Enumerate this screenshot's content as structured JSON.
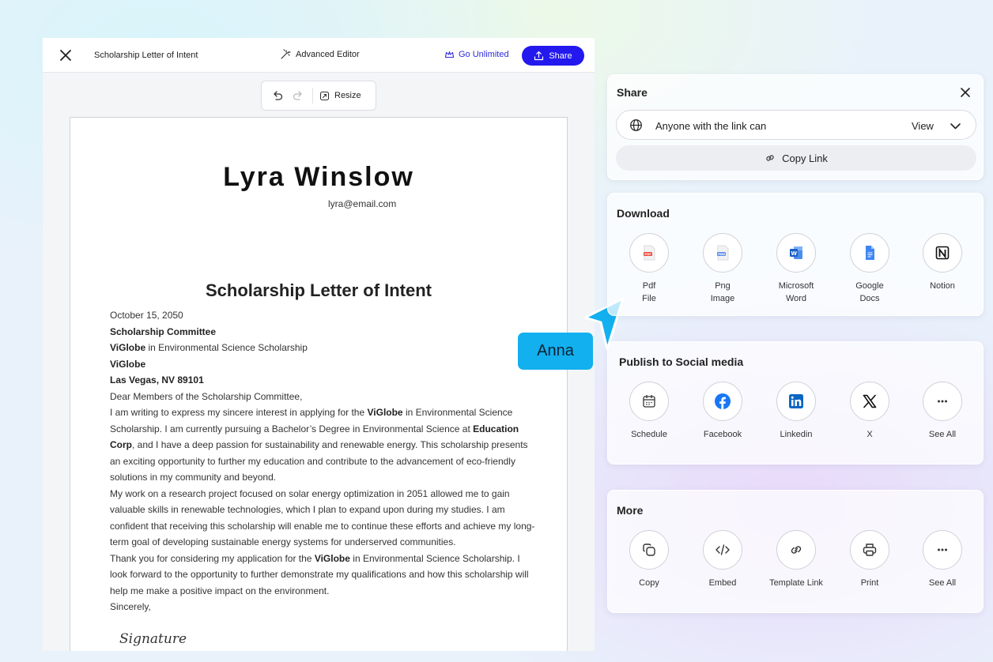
{
  "editor": {
    "doc_title": "Scholarship Letter of Intent",
    "advanced_editor": "Advanced Editor",
    "go_unlimited": "Go Unlimited",
    "share": "Share",
    "resize": "Resize"
  },
  "document": {
    "name": "Lyra Winslow",
    "email": "lyra@email.com",
    "title": "Scholarship Letter of Intent",
    "date": "October 15, 2050",
    "recipient": "Scholarship Committee",
    "org": "ViGlobe",
    "program_suffix": " in Environmental Science Scholarship",
    "org2": "ViGlobe",
    "city": "Las Vegas, NV 89101",
    "salutation": "Dear Members of the Scholarship Committee,",
    "p1_a": "I am writing to express my sincere interest in applying for the ",
    "p1_org": "ViGlobe",
    "p1_b": " in Environmental Science Scholarship. I am currently pursuing a Bachelor’s Degree in Environmental Science at ",
    "p1_corp": "Education Corp",
    "p1_c": ", and I have a deep passion for sustainability and renewable energy. This scholarship presents an exciting opportunity to further my education and contribute to the advancement of eco-friendly solutions in my community and beyond.",
    "p2": "My work on a research project focused on solar energy optimization in 2051 allowed me to gain valuable skills in renewable technologies, which I plan to expand upon during my studies. I am confident that receiving this scholarship will enable me to continue these efforts and achieve my long-term goal of developing sustainable energy systems for underserved communities.",
    "p3_a": "Thank you for considering my application for the ",
    "p3_org": "ViGlobe",
    "p3_b": " in Environmental Science Scholarship. I look forward to the opportunity to further demonstrate my qualifications and how this scholarship will help me make a positive impact on the environment.",
    "closing": "Sincerely,",
    "signature": "Signature"
  },
  "collaborator": {
    "name": "Anna",
    "color": "#12b0ef"
  },
  "share_panel": {
    "title": "Share",
    "permission_text": "Anyone with the link can",
    "permission_value": "View",
    "copy_link": "Copy Link"
  },
  "download": {
    "title": "Download",
    "items": [
      {
        "label": "Pdf\nFile",
        "icon": "pdf-file-icon"
      },
      {
        "label": "Png\nImage",
        "icon": "png-image-icon"
      },
      {
        "label": "Microsoft\nWord",
        "icon": "word-icon"
      },
      {
        "label": "Google\nDocs",
        "icon": "google-docs-icon"
      },
      {
        "label": "Notion",
        "icon": "notion-icon"
      }
    ]
  },
  "social": {
    "title": "Publish to Social media",
    "items": [
      {
        "label": "Schedule",
        "icon": "calendar-icon"
      },
      {
        "label": "Facebook",
        "icon": "facebook-icon"
      },
      {
        "label": "Linkedin",
        "icon": "linkedin-icon"
      },
      {
        "label": "X",
        "icon": "x-icon"
      },
      {
        "label": "See All",
        "icon": "more-icon"
      }
    ]
  },
  "more": {
    "title": "More",
    "items": [
      {
        "label": "Copy",
        "icon": "copy-icon"
      },
      {
        "label": "Embed",
        "icon": "embed-icon"
      },
      {
        "label": "Template Link",
        "icon": "link-icon"
      },
      {
        "label": "Print",
        "icon": "print-icon"
      },
      {
        "label": "See All",
        "icon": "more-icon"
      }
    ]
  },
  "colors": {
    "accent": "#2318ee",
    "cursor": "#12b0ef"
  }
}
